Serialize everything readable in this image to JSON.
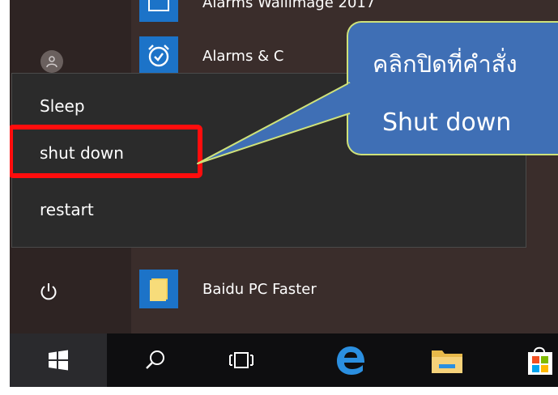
{
  "start_menu": {
    "apps": {
      "top_partial": "Alarms Wallimage 2017",
      "alarms": "Alarms & C",
      "baidu": "Baidu PC Faster"
    },
    "power_menu": {
      "sleep": "Sleep",
      "shut_down": "shut down",
      "restart": "restart"
    }
  },
  "callout": {
    "line1": "คลิกปิดที่คำสั่ง",
    "line2": "Shut down"
  },
  "colors": {
    "highlight": "#ff0d0d",
    "callout_fill": "#3f6fb5",
    "callout_border": "#cfe27a",
    "tile_blue": "#1c73c8",
    "menu_bg": "#2b2b2b",
    "taskbar_bg": "#0e0e10"
  },
  "icons": {
    "power": "power-icon",
    "windows": "windows-logo-icon",
    "search": "search-icon",
    "task_view": "task-view-icon",
    "edge": "edge-browser-icon",
    "explorer": "file-explorer-icon",
    "store": "store-icon",
    "alarms": "alarm-clock-icon",
    "user": "user-avatar-icon"
  }
}
